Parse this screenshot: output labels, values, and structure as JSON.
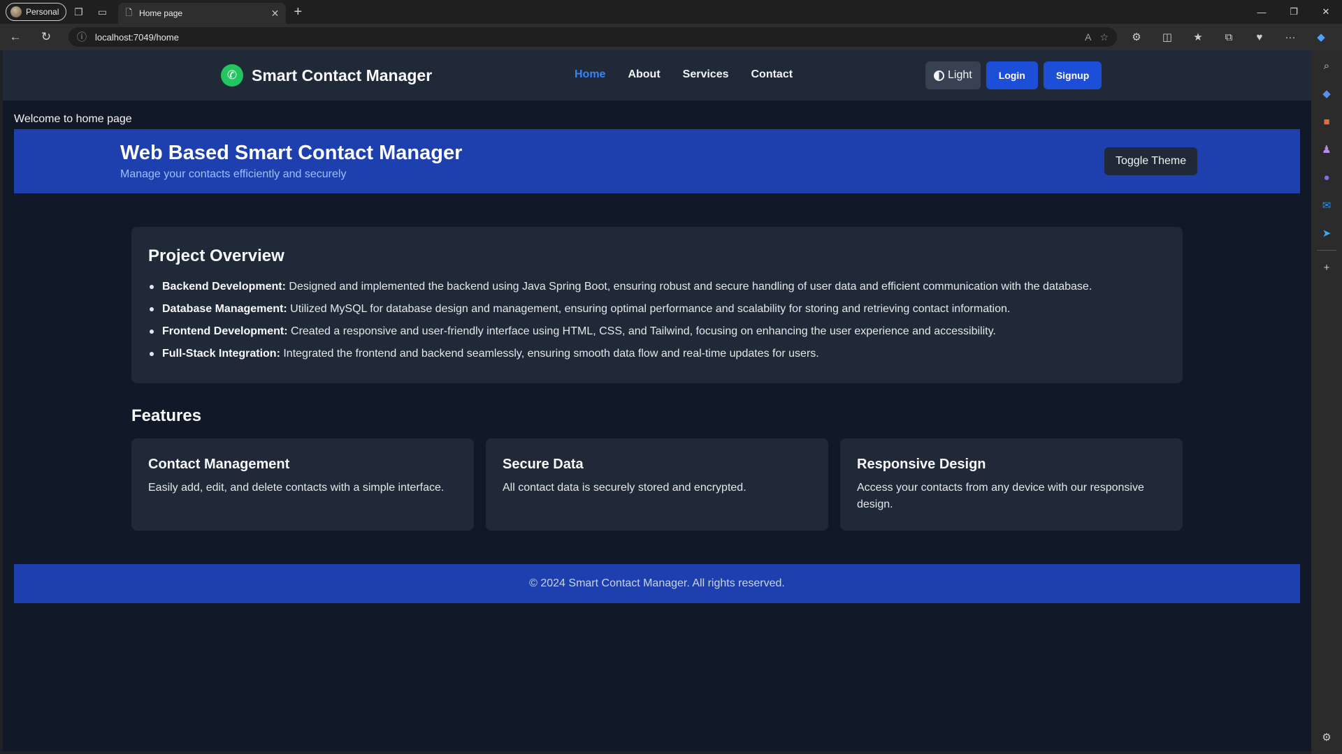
{
  "browser": {
    "profile_label": "Personal",
    "tab_title": "Home page",
    "url": "localhost:7049/home"
  },
  "site": {
    "brand": "Smart Contact Manager",
    "nav": [
      {
        "label": "Home",
        "active": true
      },
      {
        "label": "About",
        "active": false
      },
      {
        "label": "Services",
        "active": false
      },
      {
        "label": "Contact",
        "active": false
      }
    ],
    "theme_button": "Light",
    "login_button": "Login",
    "signup_button": "Signup"
  },
  "welcome_text": "Welcome to home page",
  "hero": {
    "title": "Web Based Smart Contact Manager",
    "subtitle": "Manage your contacts efficiently and securely",
    "toggle_button": "Toggle Theme"
  },
  "overview": {
    "title": "Project Overview",
    "items": [
      {
        "label": "Backend Development:",
        "text": " Designed and implemented the backend using Java Spring Boot, ensuring robust and secure handling of user data and efficient communication with the database."
      },
      {
        "label": "Database Management:",
        "text": " Utilized MySQL for database design and management, ensuring optimal performance and scalability for storing and retrieving contact information."
      },
      {
        "label": "Frontend Development:",
        "text": " Created a responsive and user-friendly interface using HTML, CSS, and Tailwind, focusing on enhancing the user experience and accessibility."
      },
      {
        "label": "Full-Stack Integration:",
        "text": " Integrated the frontend and backend seamlessly, ensuring smooth data flow and real-time updates for users."
      }
    ]
  },
  "features": {
    "title": "Features",
    "cards": [
      {
        "title": "Contact Management",
        "text": "Easily add, edit, and delete contacts with a simple interface."
      },
      {
        "title": "Secure Data",
        "text": "All contact data is securely stored and encrypted."
      },
      {
        "title": "Responsive Design",
        "text": "Access your contacts from any device with our responsive design."
      }
    ]
  },
  "footer_text": "© 2024 Smart Contact Manager. All rights reserved.",
  "colors": {
    "page_bg": "#111827",
    "navbar_bg": "#1f2937",
    "accent_blue": "#1e40af",
    "button_blue": "#1d4ed8",
    "brand_green": "#22c55e"
  },
  "icons": {
    "brand": "phone-icon",
    "theme": "half-circle-icon"
  }
}
